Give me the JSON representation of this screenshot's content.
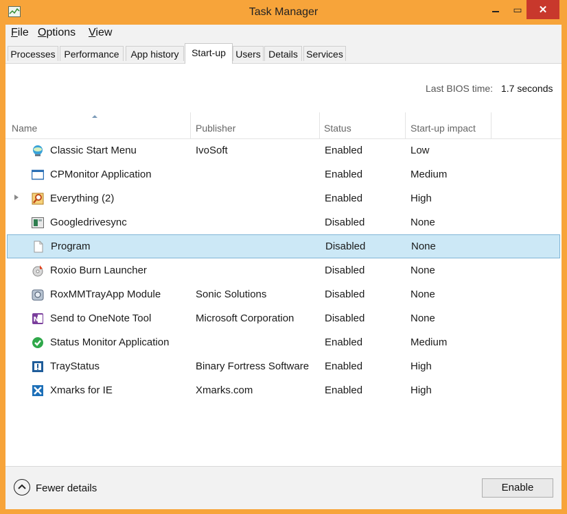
{
  "window": {
    "title": "Task Manager",
    "minimize": "",
    "maximize": "▭",
    "close": "✕"
  },
  "menu": [
    {
      "label": "File"
    },
    {
      "label": "Options"
    },
    {
      "label": "View"
    }
  ],
  "tabs": [
    {
      "label": "Processes"
    },
    {
      "label": "Performance"
    },
    {
      "label": "App history"
    },
    {
      "label": "Start-up",
      "active": true
    },
    {
      "label": "Users"
    },
    {
      "label": "Details"
    },
    {
      "label": "Services"
    }
  ],
  "bios": {
    "label": "Last BIOS time:",
    "value": "1.7 seconds"
  },
  "columns": {
    "name": "Name",
    "publisher": "Publisher",
    "status": "Status",
    "impact": "Start-up impact"
  },
  "rows": [
    {
      "name": "Classic Start Menu",
      "publisher": "IvoSoft",
      "status": "Enabled",
      "impact": "Low",
      "icon": "classic-start-menu-icon"
    },
    {
      "name": "CPMonitor Application",
      "publisher": "",
      "status": "Enabled",
      "impact": "Medium",
      "icon": "cpmonitor-icon"
    },
    {
      "name": "Everything (2)",
      "publisher": "",
      "status": "Enabled",
      "impact": "High",
      "icon": "everything-search-icon",
      "expandable": true
    },
    {
      "name": "Googledrivesync",
      "publisher": "",
      "status": "Disabled",
      "impact": "None",
      "icon": "googledrivesync-icon"
    },
    {
      "name": "Program",
      "publisher": "",
      "status": "Disabled",
      "impact": "None",
      "icon": "blank-document-icon",
      "selected": true
    },
    {
      "name": "Roxio Burn Launcher",
      "publisher": "",
      "status": "Disabled",
      "impact": "None",
      "icon": "roxio-burn-icon"
    },
    {
      "name": "RoxMMTrayApp Module",
      "publisher": "Sonic Solutions",
      "status": "Disabled",
      "impact": "None",
      "icon": "roxmm-tray-icon"
    },
    {
      "name": "Send to OneNote Tool",
      "publisher": "Microsoft Corporation",
      "status": "Disabled",
      "impact": "None",
      "icon": "onenote-icon"
    },
    {
      "name": "Status Monitor Application",
      "publisher": "",
      "status": "Enabled",
      "impact": "Medium",
      "icon": "status-monitor-icon"
    },
    {
      "name": "TrayStatus",
      "publisher": "Binary Fortress Software",
      "status": "Enabled",
      "impact": "High",
      "icon": "traystatus-icon"
    },
    {
      "name": "Xmarks for IE",
      "publisher": "Xmarks.com",
      "status": "Enabled",
      "impact": "High",
      "icon": "xmarks-icon"
    }
  ],
  "footer": {
    "fewer_details": "Fewer details",
    "enable": "Enable"
  },
  "colors": {
    "window_frame": "#f7a43a",
    "close_button": "#c8382c",
    "selection": "#cce8f6",
    "selection_border": "#7fb4d6"
  }
}
